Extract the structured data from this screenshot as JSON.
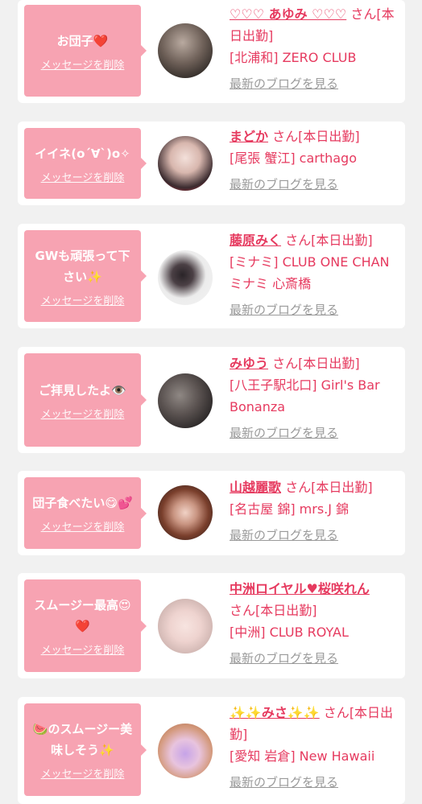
{
  "common": {
    "delete_label": "メッセージを削除",
    "blog_label": "最新のブログを見る",
    "san": "さん"
  },
  "colors": {
    "bubble": "#f7a3b2",
    "accent": "#e63a5f",
    "link_gray": "#9a9a9a"
  },
  "messages": [
    {
      "text": "お団子❤️",
      "name": "♡♡♡ あゆみ ♡♡♡",
      "status": "[本日出勤]",
      "shop": "[北浦和] ZERO CLUB"
    },
    {
      "text": "イイネ(o´∀`)o✧",
      "name": "まどか",
      "status": "[本日出勤]",
      "shop": "[尾張 蟹江] carthago"
    },
    {
      "text": "GWも頑張って下さい✨",
      "name": "藤原みく",
      "status": "[本日出勤]",
      "shop": "[ミナミ] CLUB ONE CHAN ミナミ 心斎橋"
    },
    {
      "text": "ご拝見したよ👁️",
      "name": "みゆう",
      "status": "[本日出勤]",
      "shop": "[八王子駅北口] Girl's Bar Bonanza"
    },
    {
      "text": "団子食べたい😋💕",
      "name": "山越麗歌",
      "status": "[本日出勤]",
      "shop": "[名古屋 錦] mrs.J 錦"
    },
    {
      "text": "スムージー最高😍❤️",
      "name": "中洲ロイヤル♥桜咲れん",
      "status": "[本日出勤]",
      "shop": "[中洲] CLUB ROYAL"
    },
    {
      "text": "🍉のスムージー美味しそう✨",
      "name": "✨✨みさ✨✨",
      "status": "[本日出勤]",
      "shop": "[愛知 岩倉] New Hawaii"
    }
  ]
}
